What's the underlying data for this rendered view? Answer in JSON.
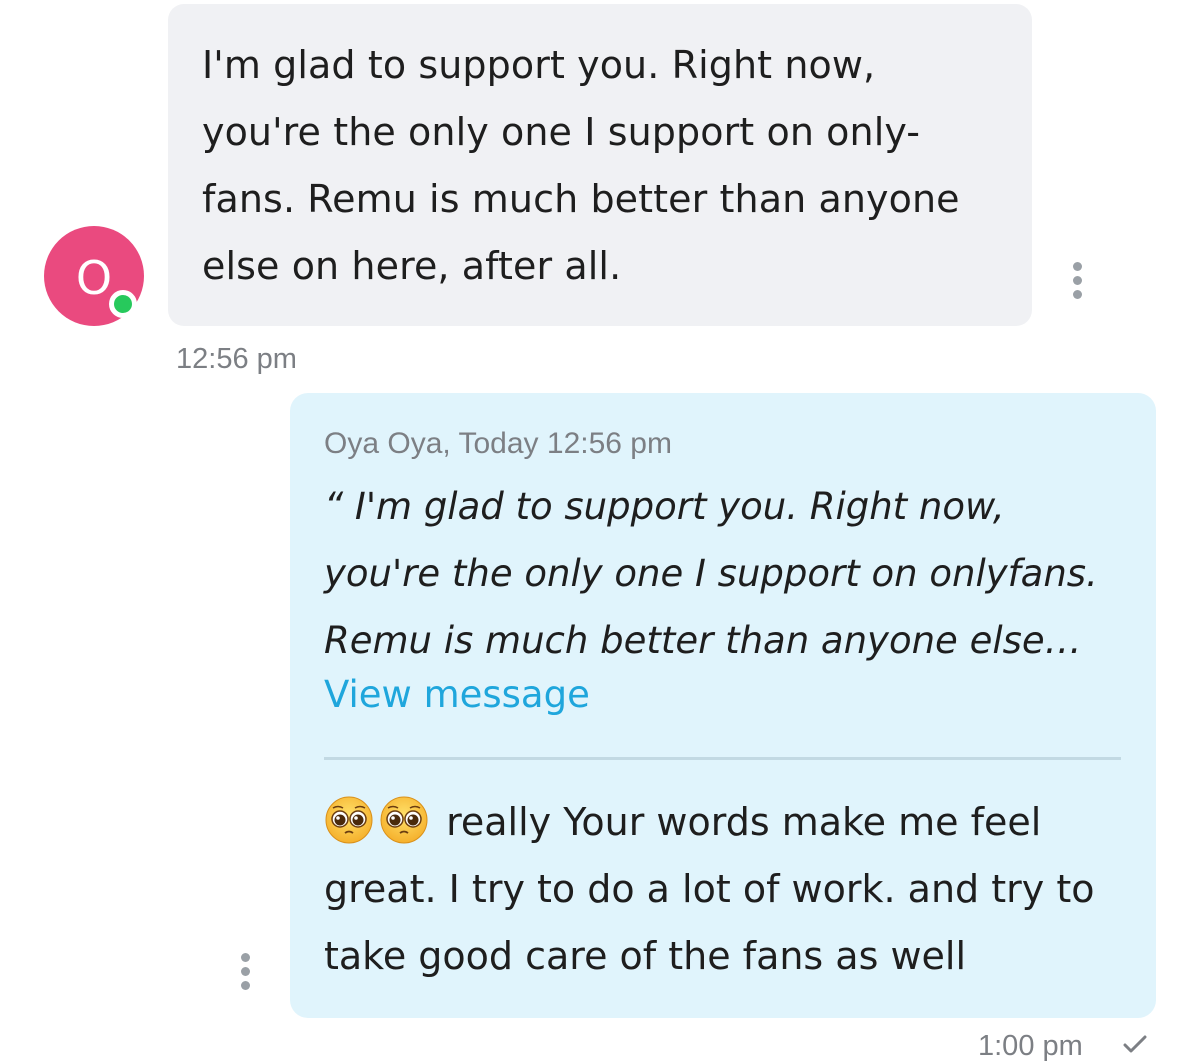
{
  "incoming": {
    "avatar_initial": "O",
    "lines": [
      "I'm glad to support you. Right now,",
      "you're the only one I support on only-",
      "fans. Remu is much better than anyone",
      "else on here, after all."
    ],
    "time": "12:56 pm",
    "more_icon": "more-vertical-icon"
  },
  "outgoing": {
    "quote_meta": "Oya Oya, Today 12:56 pm",
    "quote_lines": [
      "“ I'm glad to support you. Right now,",
      "you're the only one I support on onlyfans.",
      "Remu is much better than anyone else…"
    ],
    "view_message": "View message",
    "reply_line1_text": "really Your words make me feel",
    "reply_lines": [
      "great. I try to do a lot of work. and try to",
      "take good care of the fans as well"
    ],
    "emojis": [
      "pleading-face-emoji",
      "pleading-face-emoji"
    ],
    "time": "1:00 pm",
    "more_icon": "more-vertical-icon",
    "status_icon": "checkmark-icon"
  },
  "colors": {
    "avatar_bg": "#ea4a7f",
    "online": "#27c95c",
    "incoming_bubble": "#f0f1f4",
    "outgoing_bubble": "#e0f4fc",
    "link": "#1fa6dc",
    "meta_text": "#7c7f84"
  }
}
